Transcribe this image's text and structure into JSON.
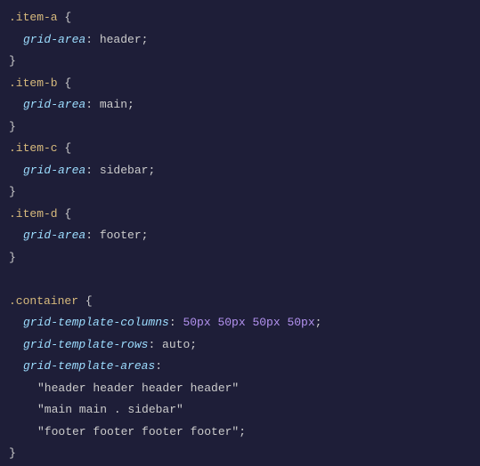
{
  "code": {
    "rules": [
      {
        "selector": ".item-a",
        "prop": "grid-area",
        "value": "header"
      },
      {
        "selector": ".item-b",
        "prop": "grid-area",
        "value": "main"
      },
      {
        "selector": ".item-c",
        "prop": "grid-area",
        "value": "sidebar"
      },
      {
        "selector": ".item-d",
        "prop": "grid-area",
        "value": "footer"
      }
    ],
    "container": {
      "selector": ".container",
      "cols_prop": "grid-template-columns",
      "cols_value": "50px 50px 50px 50px",
      "rows_prop": "grid-template-rows",
      "rows_value": "auto",
      "areas_prop": "grid-template-areas",
      "area_lines": [
        "\"header header header header\"",
        "\"main main . sidebar\"",
        "\"footer footer footer footer\""
      ]
    }
  }
}
